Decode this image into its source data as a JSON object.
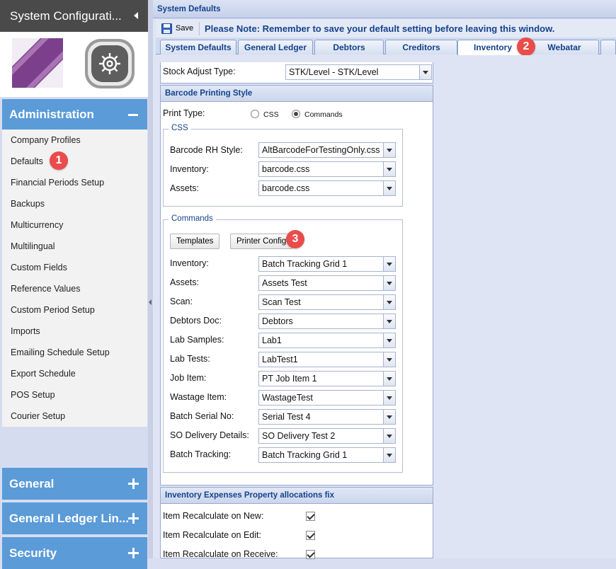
{
  "sidebar": {
    "title": "System Configurati...",
    "admin_header": "Administration",
    "admin_items": [
      "Company Profiles",
      "Defaults",
      "Financial Periods Setup",
      "Backups",
      "Multicurrency",
      "Multilingual",
      "Custom Fields",
      "Reference Values",
      "Custom Period Setup",
      "Imports",
      "Emailing Schedule Setup",
      "Export Schedule",
      "POS Setup",
      "Courier Setup"
    ],
    "sections": [
      "General",
      "General Ledger Lin...",
      "Security"
    ]
  },
  "main": {
    "title": "System Defaults",
    "toolbar": {
      "save_label": "Save",
      "note": "Please Note: Remember to save your default setting before leaving this window."
    },
    "tabs": [
      "System Defaults",
      "General Ledger",
      "Debtors",
      "Creditors",
      "Inventory",
      "Webatar"
    ],
    "active_tab": "Inventory",
    "stock_adjust": {
      "label": "Stock Adjust Type:",
      "value": "STK/Level - STK/Level"
    },
    "barcode": {
      "title": "Barcode Printing Style",
      "print_type_label": "Print Type:",
      "option_css": "CSS",
      "option_commands": "Commands",
      "selected": "Commands",
      "css_legend": "CSS",
      "css_fields": [
        {
          "label": "Barcode RH Style:",
          "value": "AltBarcodeForTestingOnly.css"
        },
        {
          "label": "Inventory:",
          "value": "barcode.css"
        },
        {
          "label": "Assets:",
          "value": "barcode.css"
        }
      ],
      "commands_legend": "Commands",
      "templates_btn": "Templates",
      "printer_config_btn": "Printer Config",
      "command_fields": [
        {
          "label": "Inventory:",
          "value": "Batch Tracking Grid 1"
        },
        {
          "label": "Assets:",
          "value": "Assets Test"
        },
        {
          "label": "Scan:",
          "value": "Scan Test"
        },
        {
          "label": "Debtors Doc:",
          "value": "Debtors"
        },
        {
          "label": "Lab Samples:",
          "value": "Lab1"
        },
        {
          "label": "Lab Tests:",
          "value": "LabTest1"
        },
        {
          "label": "Job Item:",
          "value": "PT Job Item 1"
        },
        {
          "label": "Wastage Item:",
          "value": "WastageTest"
        },
        {
          "label": "Batch Serial No:",
          "value": "Serial Test 4"
        },
        {
          "label": "SO Delivery Details:",
          "value": "SO Delivery Test 2"
        },
        {
          "label": "Batch Tracking:",
          "value": "Batch Tracking Grid 1"
        }
      ]
    },
    "expenses": {
      "title": "Inventory Expenses Property allocations fix",
      "items": [
        {
          "label": "Item Recalculate on New:",
          "checked": true
        },
        {
          "label": "Item Recalculate on Edit:",
          "checked": true
        },
        {
          "label": "Item Recalculate on Receive:",
          "checked": true
        }
      ]
    }
  },
  "badges": [
    "1",
    "2",
    "3"
  ],
  "colors": {
    "accent": "#5a9bd8",
    "header_text": "#15428b",
    "badge": "#ea4b4b",
    "brand_purple": "#7b3f8c"
  }
}
